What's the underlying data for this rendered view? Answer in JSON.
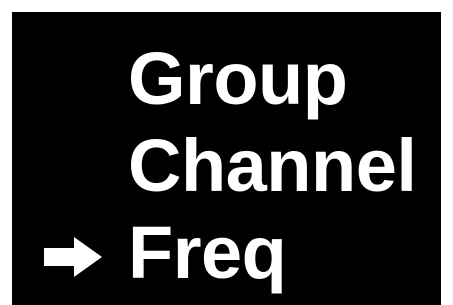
{
  "menu": {
    "items": [
      {
        "label": "Group",
        "selected": false
      },
      {
        "label": "Channel",
        "selected": false
      },
      {
        "label": "Freq",
        "selected": true
      }
    ],
    "selection_icon": "right-arrow-icon"
  },
  "colors": {
    "screen_background": "#000000",
    "text": "#ffffff",
    "border": "#ffffff"
  }
}
